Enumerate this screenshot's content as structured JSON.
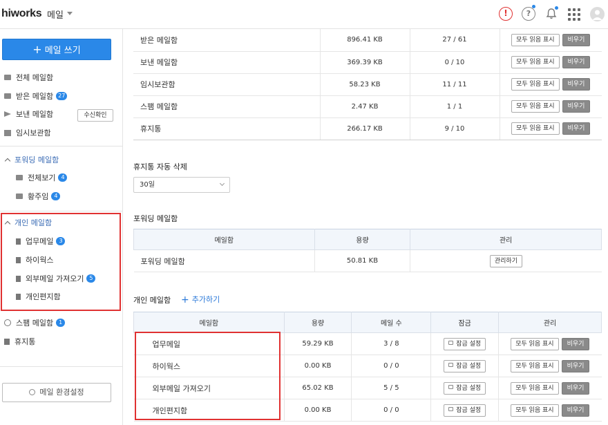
{
  "header": {
    "logo": "hiworks",
    "app_name": "메일",
    "icons": [
      "alert-icon",
      "help-icon",
      "bell-icon",
      "apps-grid-icon",
      "avatar"
    ]
  },
  "sidebar": {
    "write_button": "메일 쓰기",
    "items": [
      {
        "label": "전체 메일함",
        "badge": "",
        "icon": "mail-icon"
      },
      {
        "label": "받은 메일함",
        "badge": "27",
        "icon": "mail-icon"
      },
      {
        "label": "보낸 메일함",
        "badge": "",
        "icon": "send-icon"
      },
      {
        "label": "임시보관함",
        "badge": "",
        "icon": "box-icon"
      }
    ],
    "receive_confirm": "수신확인",
    "forwarding_group": "포워딩 메일함",
    "forwarding_items": [
      {
        "label": "전체보기",
        "badge": "4"
      },
      {
        "label": "황주임",
        "badge": "4"
      }
    ],
    "personal_group": "개인 메일함",
    "personal_items": [
      {
        "label": "업무메일",
        "badge": "3"
      },
      {
        "label": "하이웍스",
        "badge": ""
      },
      {
        "label": "외부메일 가져오기",
        "badge": "5"
      },
      {
        "label": "개인편지함",
        "badge": ""
      }
    ],
    "spam": {
      "label": "스팸 메일함",
      "badge": "1"
    },
    "trash": {
      "label": "휴지통"
    },
    "settings_button": "메일 환경설정"
  },
  "main": {
    "default_mailboxes": [
      {
        "name": "받은 메일함",
        "size": "896.41 KB",
        "count": "27 / 61"
      },
      {
        "name": "보낸 메일함",
        "size": "369.39 KB",
        "count": "0 / 10"
      },
      {
        "name": "임시보관함",
        "size": "58.23 KB",
        "count": "11 / 11"
      },
      {
        "name": "스팸 메일함",
        "size": "2.47 KB",
        "count": "1 / 1"
      },
      {
        "name": "휴지통",
        "size": "266.17 KB",
        "count": "9 / 10"
      }
    ],
    "mark_all_read": "모두 읽음 표시",
    "empty": "비우기",
    "trash_auto_delete": {
      "title": "휴지통 자동 삭제",
      "selected": "30일"
    },
    "forwarding": {
      "title": "포워딩 메일함",
      "headers": [
        "메일함",
        "용량",
        "관리"
      ],
      "rows": [
        {
          "name": "포워딩 메일함",
          "size": "50.81 KB",
          "action": "관리하기"
        }
      ]
    },
    "personal": {
      "title": "개인 메일함",
      "add_link": "추가하기",
      "headers": [
        "메일함",
        "용량",
        "메일 수",
        "잠금",
        "관리"
      ],
      "lock_setting": "잠금 설정",
      "rows": [
        {
          "name": "업무메일",
          "size": "59.29 KB",
          "count": "3 / 8"
        },
        {
          "name": "하이웍스",
          "size": "0.00 KB",
          "count": "0 / 0"
        },
        {
          "name": "외부메일 가져오기",
          "size": "65.02 KB",
          "count": "5 / 5"
        },
        {
          "name": "개인편지함",
          "size": "0.00 KB",
          "count": "0 / 0"
        }
      ]
    }
  },
  "colors": {
    "accent": "#2a88e8",
    "link": "#2a78d8",
    "highlight": "#e03131",
    "empty_button": "#8a8a8a"
  }
}
